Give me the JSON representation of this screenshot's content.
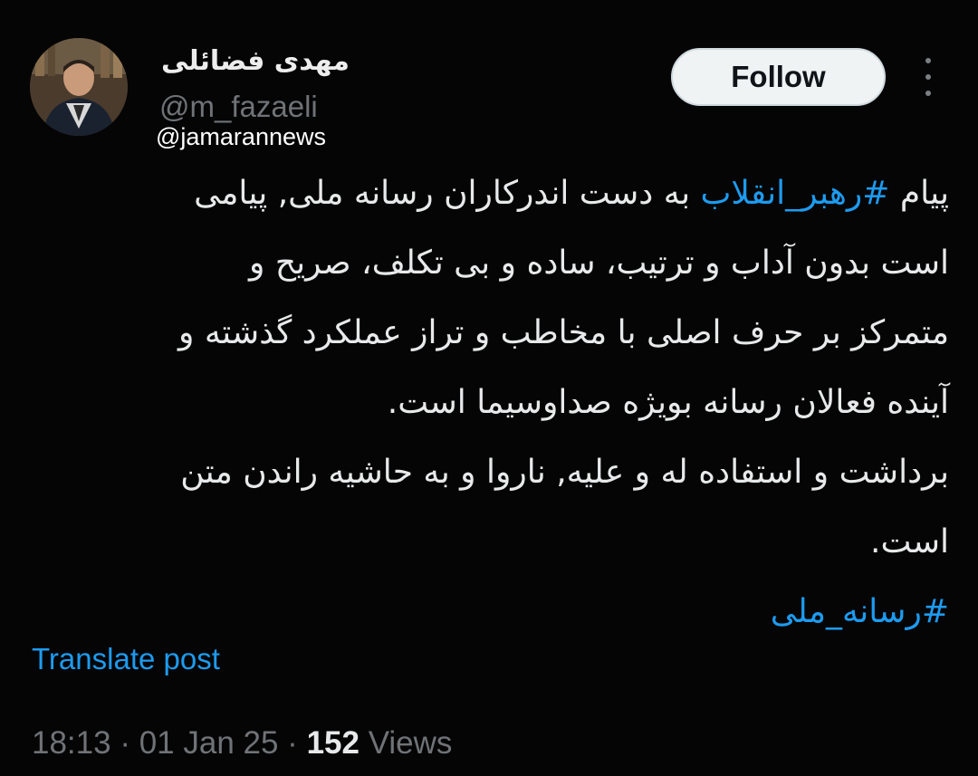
{
  "author": {
    "display_name": "مهدی فضائلی",
    "handle": "@m_fazaeli"
  },
  "watermark": "@jamarannews",
  "follow_button": {
    "label": "Follow"
  },
  "more_icon": "more-vertical-icon",
  "tweet": {
    "line1_start": "پیام ",
    "line1_hashtag": "#رهبر_انقلاب",
    "line1_end": " به دست اندرکاران رسانه ملی, پیامی",
    "line2": "است بدون آداب و ترتیب، ساده و بی تکلف، صریح و",
    "line3": "متمرکز بر حرف اصلی با مخاطب و تراز عملکرد گذشته و",
    "line4": "آینده فعالان رسانه بویژه صداوسیما است.",
    "line5": "برداشت و استفاده له و علیه, ناروا و به حاشیه راندن متن",
    "line6": "است.",
    "line7_hashtag": "#رسانه_ملی"
  },
  "translate_link": "Translate post",
  "meta": {
    "time": "18:13",
    "separator1": " · ",
    "date": "01 Jan 25",
    "separator2": " · ",
    "views_count": "152",
    "views_label": " Views"
  },
  "colors": {
    "background": "#000000",
    "text": "#e7e9ea",
    "muted": "#6f7377",
    "link": "#1d9bf0",
    "follow_bg": "#eff3f4"
  }
}
